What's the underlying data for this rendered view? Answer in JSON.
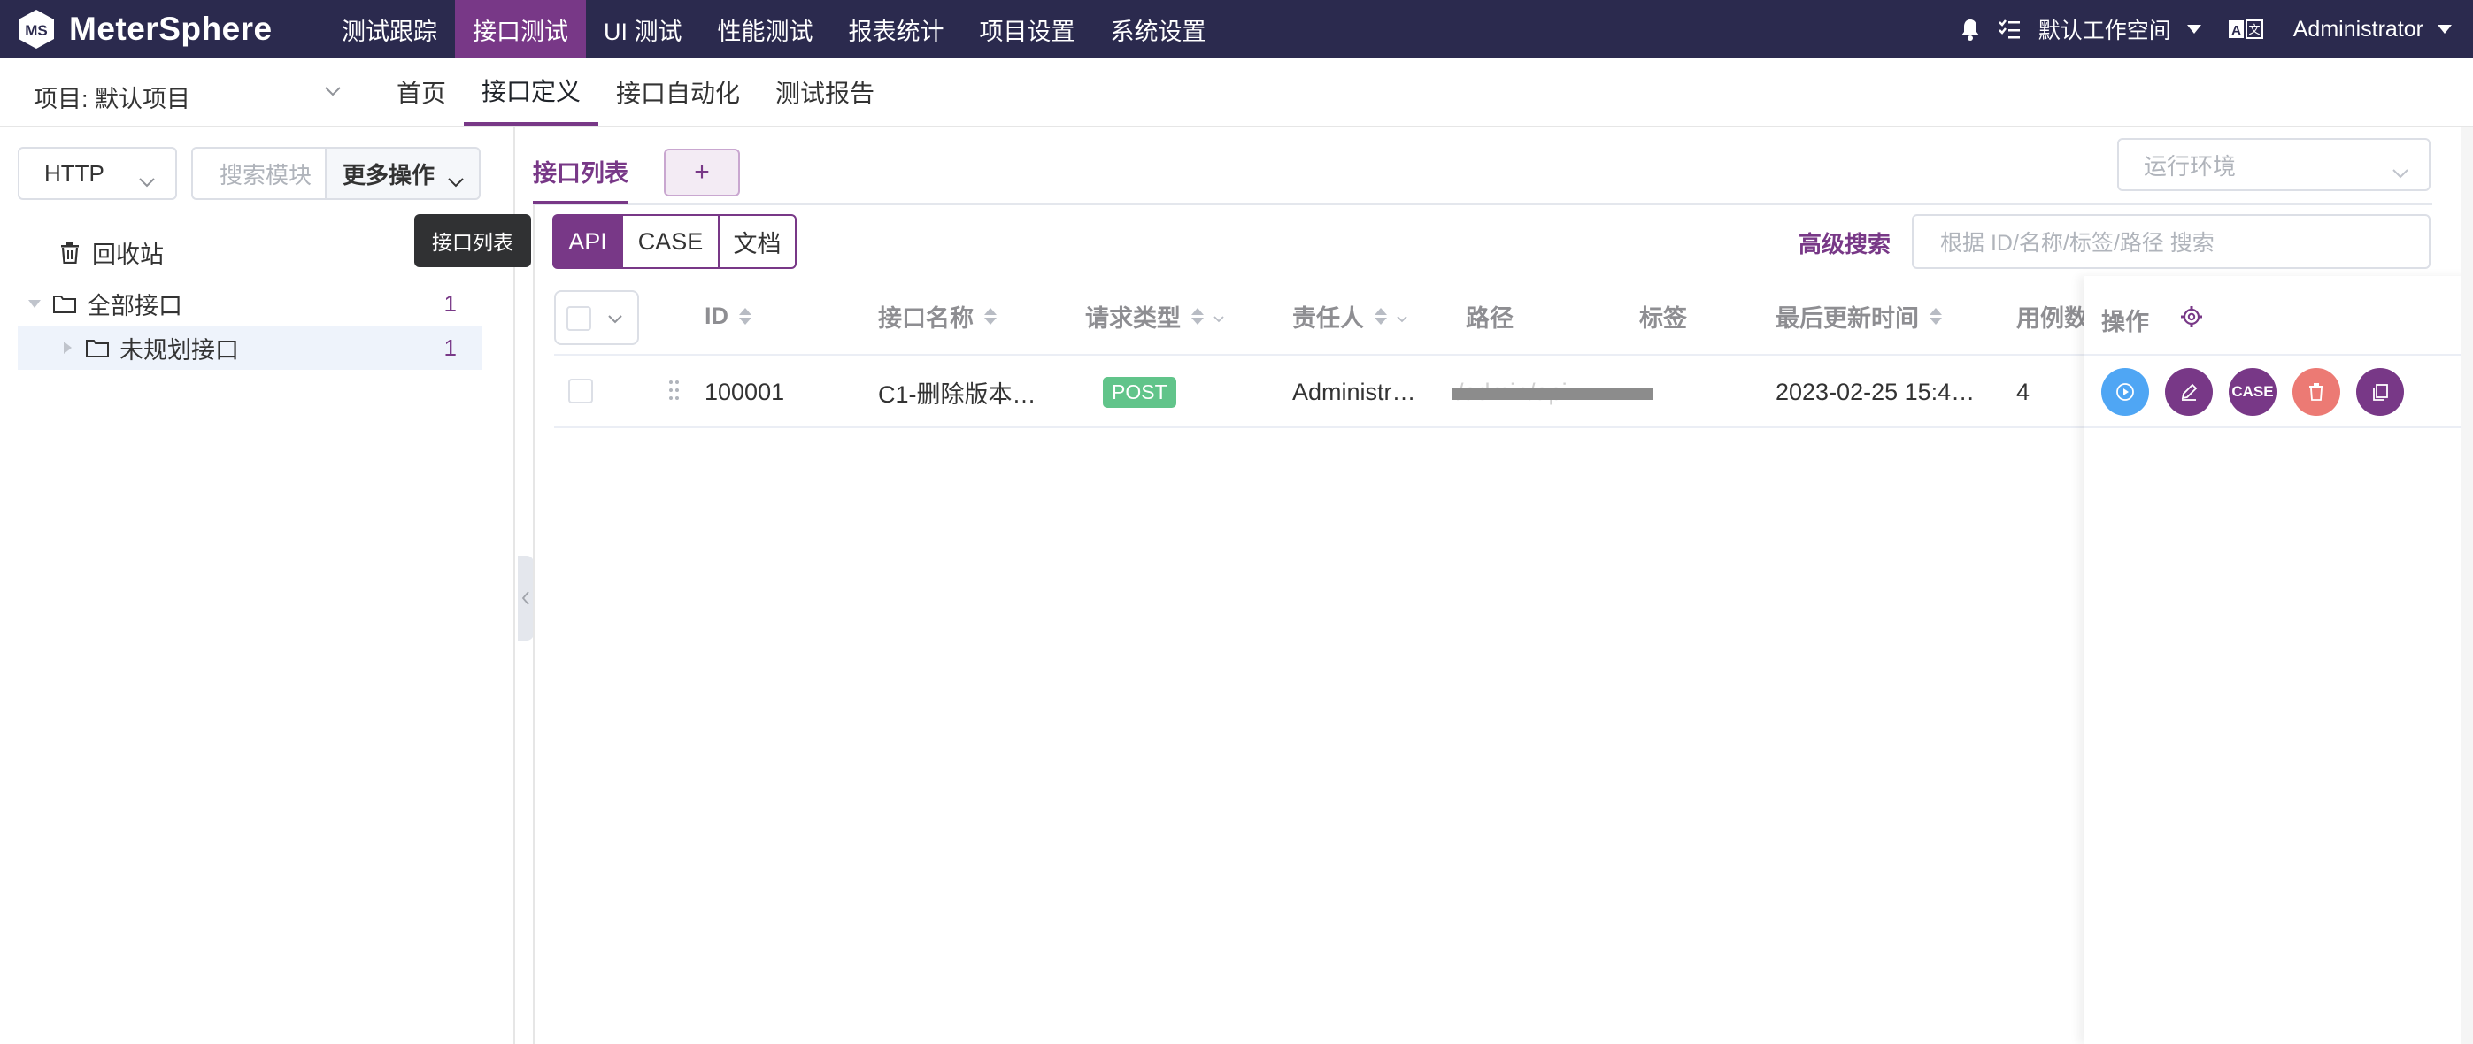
{
  "brand": {
    "name": "MeterSphere",
    "accent": "#783887",
    "topbar_bg": "#2b2a4e"
  },
  "topnav": {
    "items": [
      "测试跟踪",
      "接口测试",
      "UI 测试",
      "性能测试",
      "报表统计",
      "项目设置",
      "系统设置"
    ],
    "active_index": 1
  },
  "topright": {
    "workspace": "默认工作空间",
    "lang_icon": "translate-icon",
    "user": "Administrator"
  },
  "subbar": {
    "project": "项目: 默认项目",
    "items": [
      "首页",
      "接口定义",
      "接口自动化",
      "测试报告"
    ],
    "active_index": 1
  },
  "left": {
    "protocol": "HTTP",
    "search_placeholder": "搜索模块",
    "more_ops": "更多操作",
    "tooltip": "接口列表",
    "recycle": "回收站",
    "tree": [
      {
        "label": "全部接口",
        "count": "1"
      },
      {
        "label": "未规划接口",
        "count": "1"
      }
    ]
  },
  "main": {
    "tab": "接口列表",
    "add_tab": "+",
    "env_placeholder": "运行环境",
    "segments": [
      "API",
      "CASE",
      "文档"
    ],
    "adv_search": "高级搜索",
    "search_placeholder": "根据 ID/名称/标签/路径 搜索",
    "columns": [
      "ID",
      "接口名称",
      "请求类型",
      "责任人",
      "路径",
      "标签",
      "最后更新时间",
      "用例数",
      "操作"
    ],
    "rows": [
      {
        "id": "100001",
        "name": "C1-删除版本…",
        "method": "POST",
        "owner": "Administr…",
        "path": "/admin/api…",
        "tags": "",
        "updated": "2023-02-25 15:4…",
        "cases": "4"
      }
    ],
    "row_actions": [
      {
        "icon": "play-icon",
        "label": ""
      },
      {
        "icon": "edit-icon",
        "label": ""
      },
      {
        "icon": "case-icon",
        "label": "CASE"
      },
      {
        "icon": "delete-icon",
        "label": ""
      },
      {
        "icon": "copy-icon",
        "label": ""
      }
    ]
  }
}
